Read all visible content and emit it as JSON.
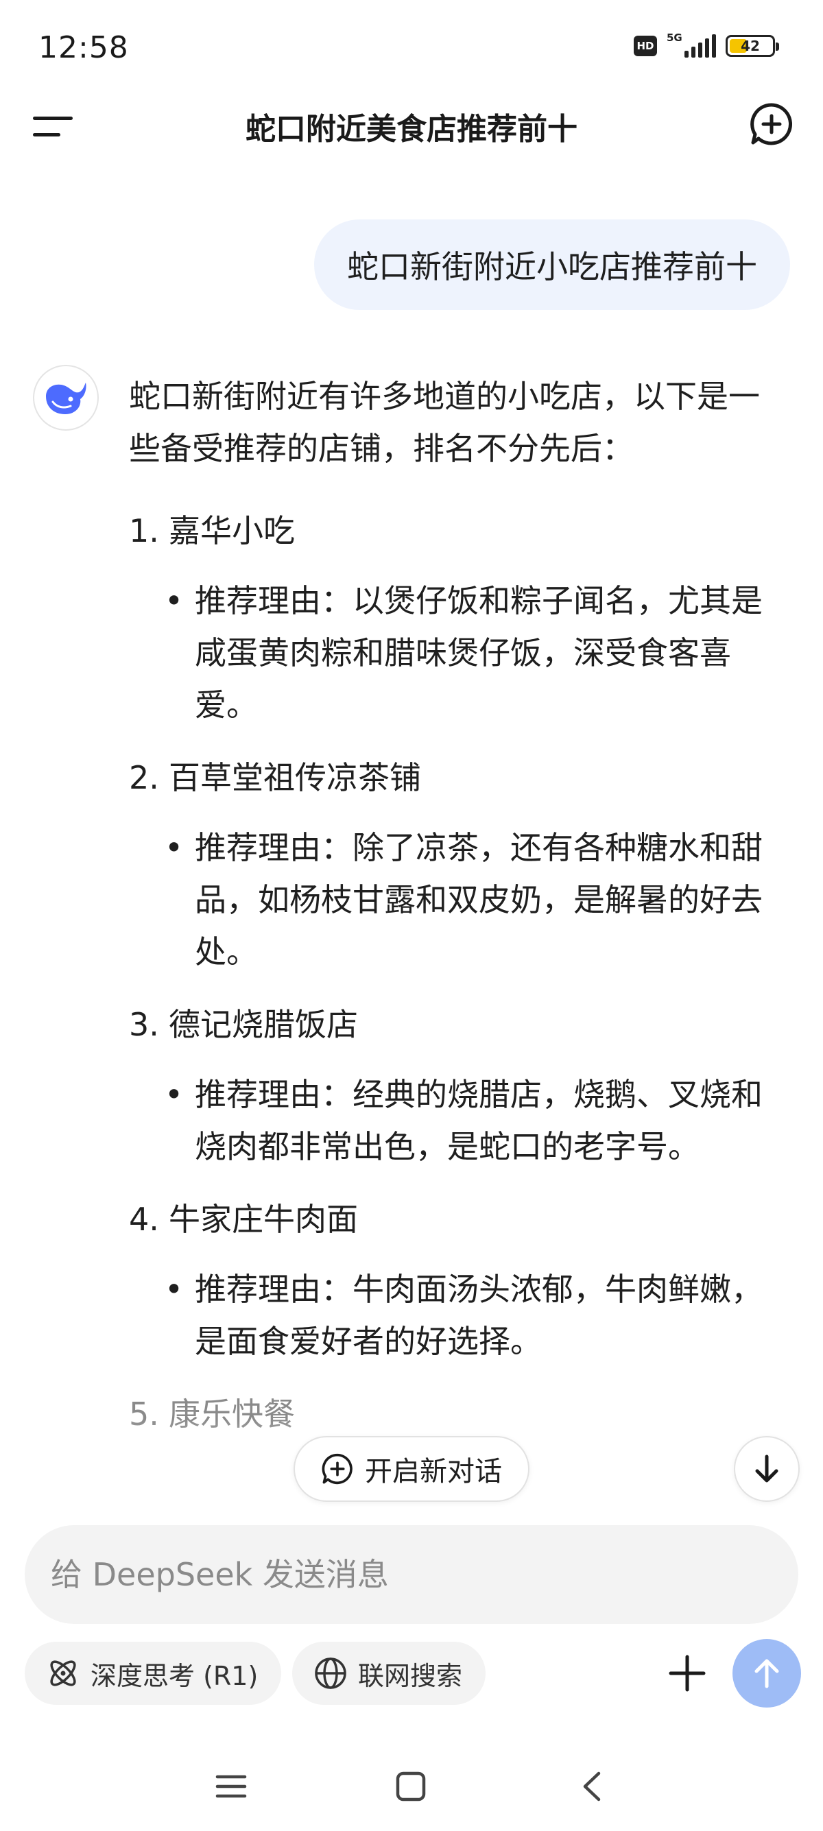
{
  "status_bar": {
    "time": "12:58",
    "hd": "HD",
    "network": "5G",
    "battery_level": 42,
    "battery_text": "42"
  },
  "header": {
    "title": "蛇口附近美食店推荐前十"
  },
  "user_message": "蛇口新街附近小吃店推荐前十",
  "answer": {
    "intro": "蛇口新街附近有许多地道的小吃店，以下是一些备受推荐的店铺，排名不分先后：",
    "items": [
      {
        "num": "1.",
        "name": "嘉华小吃",
        "reason": "推荐理由：以煲仔饭和粽子闻名，尤其是咸蛋黄肉粽和腊味煲仔饭，深受食客喜爱。"
      },
      {
        "num": "2.",
        "name": "百草堂祖传凉茶铺",
        "reason": "推荐理由：除了凉茶，还有各种糖水和甜品，如杨枝甘露和双皮奶，是解暑的好去处。"
      },
      {
        "num": "3.",
        "name": "德记烧腊饭店",
        "reason": "推荐理由：经典的烧腊店，烧鹅、叉烧和烧肉都非常出色，是蛇口的老字号。"
      },
      {
        "num": "4.",
        "name": "牛家庄牛肉面",
        "reason": "推荐理由：牛肉面汤头浓郁，牛肉鲜嫩，是面食爱好者的好选择。"
      },
      {
        "num": "5.",
        "name": "康乐快餐"
      }
    ]
  },
  "floating": {
    "new_chat_label": "开启新对话"
  },
  "input": {
    "placeholder": "给 DeepSeek 发送消息"
  },
  "chips": {
    "deep_think": "深度思考 (R1)",
    "web_search": "联网搜索"
  },
  "colors": {
    "accent": "#4d6bfe",
    "send_button": "#9ebcf6",
    "user_bubble": "#eef3fd",
    "input_bg": "#f3f3f3",
    "battery": "#f5c400"
  },
  "icons": {
    "menu": "menu-icon",
    "new_chat": "chat-plus-icon",
    "avatar": "whale-icon",
    "scroll_down": "arrow-down-icon",
    "deep_think": "atom-icon",
    "web_search": "globe-icon",
    "plus": "plus-icon",
    "send": "arrow-up-icon",
    "nav_menu": "hamburger-icon",
    "nav_home": "square-icon",
    "nav_back": "chevron-left-icon"
  }
}
